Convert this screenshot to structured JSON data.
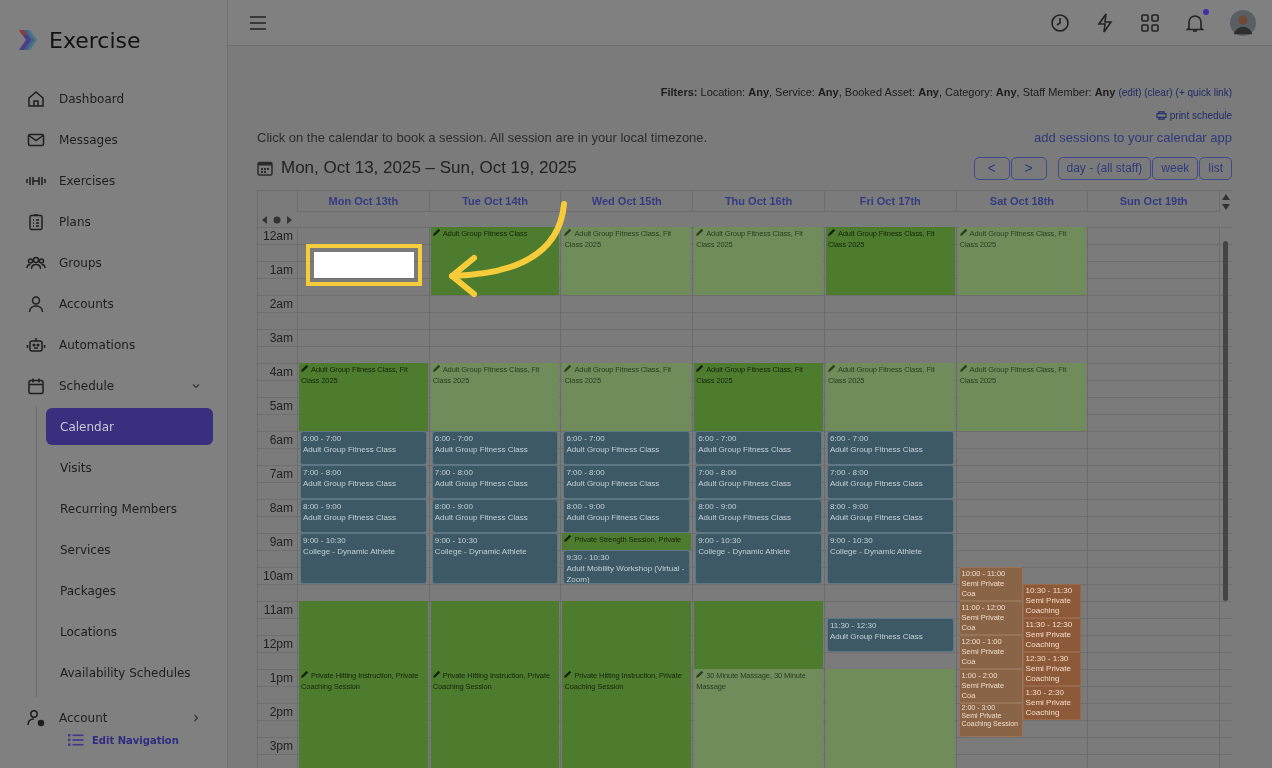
{
  "brand": {
    "name": "Exercise"
  },
  "sidebar": {
    "items": [
      {
        "label": "Dashboard",
        "selected": false
      },
      {
        "label": "Messages",
        "selected": false
      },
      {
        "label": "Exercises",
        "selected": false
      },
      {
        "label": "Plans",
        "selected": false
      },
      {
        "label": "Groups",
        "selected": false
      },
      {
        "label": "Accounts",
        "selected": false
      },
      {
        "label": "Automations",
        "selected": false
      },
      {
        "label": "Schedule",
        "selected": false,
        "expanded": true,
        "children": [
          {
            "label": "Calendar",
            "selected": true
          },
          {
            "label": "Visits",
            "selected": false
          },
          {
            "label": "Recurring Members",
            "selected": false
          },
          {
            "label": "Services",
            "selected": false
          },
          {
            "label": "Packages",
            "selected": false
          },
          {
            "label": "Locations",
            "selected": false
          },
          {
            "label": "Availability Schedules",
            "selected": false
          }
        ]
      },
      {
        "label": "Account",
        "selected": false,
        "expanded": false
      }
    ],
    "edit_navigation": "Edit Navigation"
  },
  "topbar": {
    "notification_dot": true
  },
  "filters": {
    "text": "**Filters:** Location: **Any**, Service: **Any**, Booked Asset: **Any**, Category: **Any**, Staff Member: **Any**",
    "links": [
      "(edit)",
      "(clear)",
      "(+ quick link)"
    ]
  },
  "print_link": "print schedule",
  "instructions": "Click on the calendar to book a session. All session are in your local timezone.",
  "calendar_app_link": "add sessions to your calendar app",
  "date_range": "Mon, Oct 13, 2025 – Sun, Oct 19, 2025",
  "nav_buttons": [
    "<",
    ">"
  ],
  "view_buttons": [
    {
      "label": "day - (all staff)",
      "selected": false
    },
    {
      "label": "week",
      "selected": false
    },
    {
      "label": "list",
      "selected": false
    }
  ],
  "hours": [
    "12am",
    "1am",
    "2am",
    "3am",
    "4am",
    "5am",
    "6am",
    "7am",
    "8am",
    "9am",
    "10am",
    "11am",
    "12pm",
    "1pm",
    "2pm",
    "3pm"
  ],
  "days": [
    {
      "header": "Mon Oct 13th",
      "slots": [
        {
          "kind": "empty"
        },
        {
          "kind": "empty"
        },
        {
          "kind": "empty"
        },
        {
          "kind": "empty"
        },
        {
          "kind": "available",
          "label": "Adult Group Fitness Class, Fit Class 2025"
        },
        {
          "kind": "available"
        },
        {
          "kind": "empty"
        },
        {
          "kind": "empty"
        },
        {
          "kind": "empty"
        },
        {
          "kind": "empty"
        },
        {
          "kind": "empty"
        },
        {
          "kind": "available"
        },
        {
          "kind": "available"
        },
        {
          "kind": "available",
          "label": "Private Hitting Instruction, Private Coaching Session"
        },
        {
          "kind": "available"
        },
        {
          "kind": "available"
        }
      ],
      "sessions": [
        {
          "kind": "class",
          "time": "6:00 - 7:00",
          "title": "Adult Group Fitness Class"
        },
        {
          "kind": "class",
          "time": "7:00 - 8:00",
          "title": "Adult Group Fitness Class"
        },
        {
          "kind": "class",
          "time": "8:00 - 9:00",
          "title": "Adult Group Fitness Class"
        },
        {
          "kind": "class",
          "time": "9:00 - 10:30",
          "title": "College - Dynamic Athlete"
        }
      ]
    },
    {
      "header": "Tue Oct 14th",
      "slots": [
        {
          "kind": "available",
          "label": "Adult Group Fitness Class"
        },
        {
          "kind": "available"
        },
        {
          "kind": "empty"
        },
        {
          "kind": "empty"
        },
        {
          "kind": "faded",
          "label": "Adult Group Fitness Class, Fit Class 2025"
        },
        {
          "kind": "faded"
        },
        {
          "kind": "empty"
        },
        {
          "kind": "empty"
        },
        {
          "kind": "empty"
        },
        {
          "kind": "empty"
        },
        {
          "kind": "empty"
        },
        {
          "kind": "available"
        },
        {
          "kind": "available"
        },
        {
          "kind": "available",
          "label": "Private Hitting Instruction, Private Coaching Session"
        },
        {
          "kind": "available"
        },
        {
          "kind": "available"
        }
      ],
      "sessions": [
        {
          "kind": "class",
          "time": "6:00 - 7:00",
          "title": "Adult Group Fitness Class"
        },
        {
          "kind": "class",
          "time": "7:00 - 8:00",
          "title": "Adult Group Fitness Class"
        },
        {
          "kind": "class",
          "time": "8:00 - 9:00",
          "title": "Adult Group Fitness Class"
        },
        {
          "kind": "class",
          "time": "9:00 - 10:30",
          "title": "College - Dynamic Athlete"
        }
      ]
    },
    {
      "header": "Wed Oct 15th",
      "slots": [
        {
          "kind": "faded",
          "label": "Adult Group Fitness Class, Fit Class 2025"
        },
        {
          "kind": "faded"
        },
        {
          "kind": "empty"
        },
        {
          "kind": "empty"
        },
        {
          "kind": "faded",
          "label": "Adult Group Fitness Class, Fit Class 2025"
        },
        {
          "kind": "faded"
        },
        {
          "kind": "empty"
        },
        {
          "kind": "empty"
        },
        {
          "kind": "empty"
        },
        {
          "kind": "available-half",
          "label": "Private Strength Session, Private"
        },
        {
          "kind": "empty"
        },
        {
          "kind": "available"
        },
        {
          "kind": "available"
        },
        {
          "kind": "available",
          "label": "Private Hitting Instruction, Private Coaching Session"
        },
        {
          "kind": "available"
        },
        {
          "kind": "available"
        }
      ],
      "sessions": [
        {
          "kind": "class",
          "time": "6:00 - 7:00",
          "title": "Adult Group Fitness Class"
        },
        {
          "kind": "class",
          "time": "7:00 - 8:00",
          "title": "Adult Group Fitness Class"
        },
        {
          "kind": "class",
          "time": "8:00 - 9:00",
          "title": "Adult Group Fitness Class"
        },
        {
          "kind": "class",
          "time": "9:30 - 10:30",
          "title": "Adult Mobility Workshop (Virtual - Zoom)"
        }
      ]
    },
    {
      "header": "Thu Oct 16th",
      "slots": [
        {
          "kind": "faded",
          "label": "Adult Group Fitness Class, Fit Class 2025"
        },
        {
          "kind": "faded"
        },
        {
          "kind": "empty"
        },
        {
          "kind": "empty"
        },
        {
          "kind": "available",
          "label": "Adult Group Fitness Class, Fit Class 2025"
        },
        {
          "kind": "available"
        },
        {
          "kind": "empty"
        },
        {
          "kind": "empty"
        },
        {
          "kind": "empty"
        },
        {
          "kind": "empty"
        },
        {
          "kind": "empty"
        },
        {
          "kind": "available"
        },
        {
          "kind": "available"
        },
        {
          "kind": "faded",
          "label": "30 Minute Massage, 30 Minute Massage"
        },
        {
          "kind": "faded"
        },
        {
          "kind": "faded"
        }
      ],
      "sessions": [
        {
          "kind": "class",
          "time": "6:00 - 7:00",
          "title": "Adult Group Fitness Class"
        },
        {
          "kind": "class",
          "time": "7:00 - 8:00",
          "title": "Adult Group Fitness Class"
        },
        {
          "kind": "class",
          "time": "8:00 - 9:00",
          "title": "Adult Group Fitness Class"
        },
        {
          "kind": "class",
          "time": "9:00 - 10:30",
          "title": "College - Dynamic Athlete"
        }
      ]
    },
    {
      "header": "Fri Oct 17th",
      "slots": [
        {
          "kind": "available",
          "label": "Adult Group Fitness Class, Fit Class 2025"
        },
        {
          "kind": "available"
        },
        {
          "kind": "empty"
        },
        {
          "kind": "empty"
        },
        {
          "kind": "faded",
          "label": "Adult Group Fitness Class, Fit Class 2025"
        },
        {
          "kind": "faded"
        },
        {
          "kind": "empty"
        },
        {
          "kind": "empty"
        },
        {
          "kind": "empty"
        },
        {
          "kind": "empty"
        },
        {
          "kind": "empty"
        },
        {
          "kind": "empty"
        },
        {
          "kind": "empty"
        },
        {
          "kind": "faded"
        },
        {
          "kind": "faded"
        },
        {
          "kind": "faded"
        }
      ],
      "sessions": [
        {
          "kind": "class",
          "time": "6:00 - 7:00",
          "title": "Adult Group Fitness Class"
        },
        {
          "kind": "class",
          "time": "7:00 - 8:00",
          "title": "Adult Group Fitness Class"
        },
        {
          "kind": "class",
          "time": "8:00 - 9:00",
          "title": "Adult Group Fitness Class"
        },
        {
          "kind": "class",
          "time": "9:00 - 10:30",
          "title": "College - Dynamic Athlete"
        },
        {
          "kind": "class",
          "time": "11:30 - 12:30",
          "title": "Adult Group Fitness Class"
        }
      ]
    },
    {
      "header": "Sat Oct 18th",
      "slots": [
        {
          "kind": "faded",
          "label": "Adult Group Fitness Class, Fit Class 2025"
        },
        {
          "kind": "faded"
        },
        {
          "kind": "empty"
        },
        {
          "kind": "empty"
        },
        {
          "kind": "faded",
          "label": "Adult Group Fitness Class, Fit Class 2025"
        },
        {
          "kind": "faded"
        }
      ],
      "sessions": [
        {
          "kind": "coaching",
          "time": "10:00 - 11:00",
          "title": "Semi Private Coa"
        },
        {
          "kind": "coaching-overlap",
          "time": "10:30 - 11:30",
          "title": "Semi Private Coaching"
        },
        {
          "kind": "coaching",
          "time": "11:00 - 12:00",
          "title": "Semi Private Coa"
        },
        {
          "kind": "coaching-overlap",
          "time": "11:30 - 12:30",
          "title": "Semi Private Coaching"
        },
        {
          "kind": "coaching",
          "time": "12:00 - 1:00",
          "title": "Semi Private Coa"
        },
        {
          "kind": "coaching-overlap",
          "time": "12:30 - 1:30",
          "title": "Semi Private Coaching"
        },
        {
          "kind": "coaching",
          "time": "1:00 - 2:00",
          "title": "Semi Private Coa"
        },
        {
          "kind": "coaching-overlap",
          "time": "1:30 - 2:30",
          "title": "Semi Private Coaching"
        },
        {
          "kind": "coaching-wide",
          "time": "2:00 - 3:00",
          "title": "Semi Private Coaching Session"
        }
      ]
    },
    {
      "header": "Sun Oct 19th"
    }
  ]
}
